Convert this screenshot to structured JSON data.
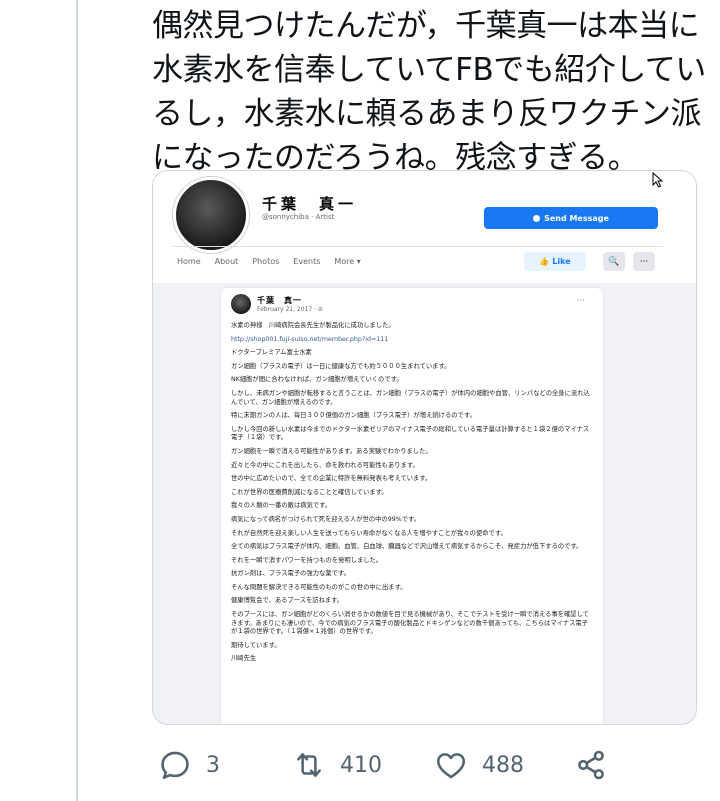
{
  "tweet": {
    "text": "偶然見つけたんだが，千葉真一は本当に\n水素水を信奉していてFBでも紹介してい\nるし，水素水に頼るあまり反ワクチン派\nになったのだろうね。残念すぎる。"
  },
  "fb_page": {
    "name": "千葉　真一",
    "subtitle": "@sonnychiba · Artist",
    "send_message_label": "Send Message",
    "nav": [
      "Home",
      "About",
      "Photos",
      "Events",
      "More ▾"
    ],
    "like_label": "Like",
    "search_glyph": "🔍",
    "more_glyph": "···"
  },
  "fb_post": {
    "author": "千葉　真一",
    "date": "February 21, 2017 · ⊘",
    "paragraphs": [
      "水素の神様　川崎病院会長先生が製品化に成功しました。",
      "http://shop001.fuji-suiso.net/member.php?id=111",
      "ドクタープレミアム富士水素",
      "ガン細胞（プラスの電子）は一日に健康な方でも約５０００生まれています。",
      "NK細胞が間に合わなければ、ガン細胞が増えていくのです。",
      "しかし、未病ガンや細胞が転移すると言うことは、ガン細胞（プラスの電子）が体内の細胞や血管、リンパなどの全身に流れ込んでいて、ガン細胞が増えるのです。",
      "特に末期ガンの人は、毎日３００億個のガン細胞（プラス電子）が増え続けるのです。",
      "しかし今回の新しい水素は今までのドクター水素ゼリアのマイナス電子の総和している電子量は計算すると１袋２億のマイナス電子（１袋）です。",
      "ガン細胞を一瞬で消える可能性があります。ある実験でわかりました。",
      "近々と今の中にこれを出したら、命を救われる可能性もあります。",
      "世の中に広めたいので、全ての企業に特許を無料発表も考えています。",
      "これが世界の医療費削減になることと確信しています。",
      "我々の人類の一番の敵は病気です。",
      "病気になって病名がつけられて死を迎える人が世の中の99%です。",
      "それが自然死を迎え楽しい人生を送ってもらい寿命がなくなる人を増やすことが我々の使命です。",
      "全ての病気はプラス電子が体内、細胞、血管、白血球、臓器などで沢山増えて病気するからこそ、発症力が低下するのです。",
      "それを一瞬で消すパワーを持つものを発明しました。",
      "抗ガン剤は、プラス電子の強力な薬です。",
      "そんな問題を解決できる可能性のものがこの世の中に出ます。",
      "健康博覧会で、あるブースを訪ねます。",
      "そのブースには、ガン細胞がどのくらい消せるかの数値を目で見る機械があり、そこでテストを受け一瞬で消える事を確認してきます。あまりにも凄いので、今での病気のプラス電子の酸化製品とドキシゲンなどの数千個あっても、こちらはマイナス電子が１袋の世界です。（１袋億×１兆個）の世界です。",
      "期待しています。",
      "川崎先生"
    ]
  },
  "actions": {
    "replies": "3",
    "retweets": "410",
    "likes": "488"
  },
  "colors": {
    "fb_blue": "#1877f2",
    "icon_gray": "#536471",
    "divider": "#cfd9de"
  }
}
